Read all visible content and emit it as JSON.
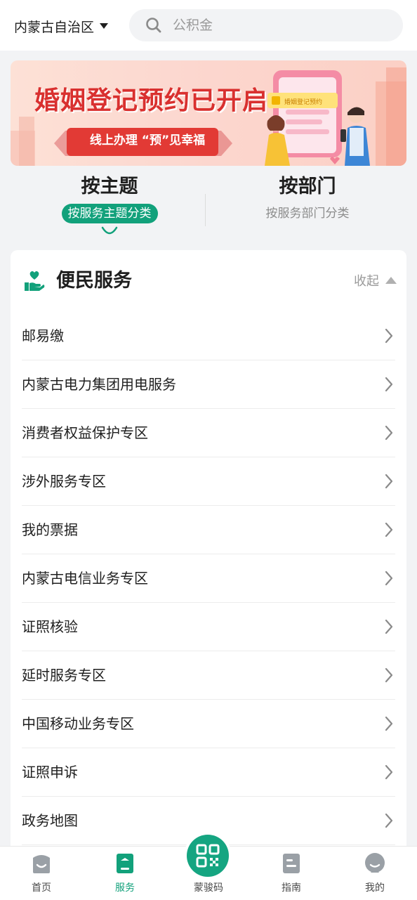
{
  "header": {
    "region": "内蒙古自治区",
    "search_placeholder": "公积金"
  },
  "banner": {
    "title": "婚姻登记预约已开启",
    "subtitle": "线上办理 “预”见幸福",
    "phone_badge": "婚姻登记预约"
  },
  "tabs": [
    {
      "title": "按主题",
      "subtitle": "按服务主题分类",
      "active": true
    },
    {
      "title": "按部门",
      "subtitle": "按服务部门分类",
      "active": false
    }
  ],
  "section": {
    "title": "便民服务",
    "collapse_label": "收起",
    "items": [
      {
        "label": "邮易缴"
      },
      {
        "label": "内蒙古电力集团用电服务"
      },
      {
        "label": "消费者权益保护专区"
      },
      {
        "label": "涉外服务专区"
      },
      {
        "label": "我的票据"
      },
      {
        "label": "内蒙古电信业务专区"
      },
      {
        "label": "证照核验"
      },
      {
        "label": "延时服务专区"
      },
      {
        "label": "中国移动业务专区"
      },
      {
        "label": "证照申诉"
      },
      {
        "label": "政务地图"
      }
    ]
  },
  "bottom_nav": {
    "items": [
      {
        "label": "首页",
        "icon": "home-icon"
      },
      {
        "label": "服务",
        "icon": "bookmark-icon"
      },
      {
        "label": "蒙骏码",
        "icon": "qr-code-icon"
      },
      {
        "label": "指南",
        "icon": "guide-icon"
      },
      {
        "label": "我的",
        "icon": "profile-icon"
      }
    ]
  },
  "colors": {
    "accent": "#12a17b",
    "banner_red": "#d9302f"
  }
}
